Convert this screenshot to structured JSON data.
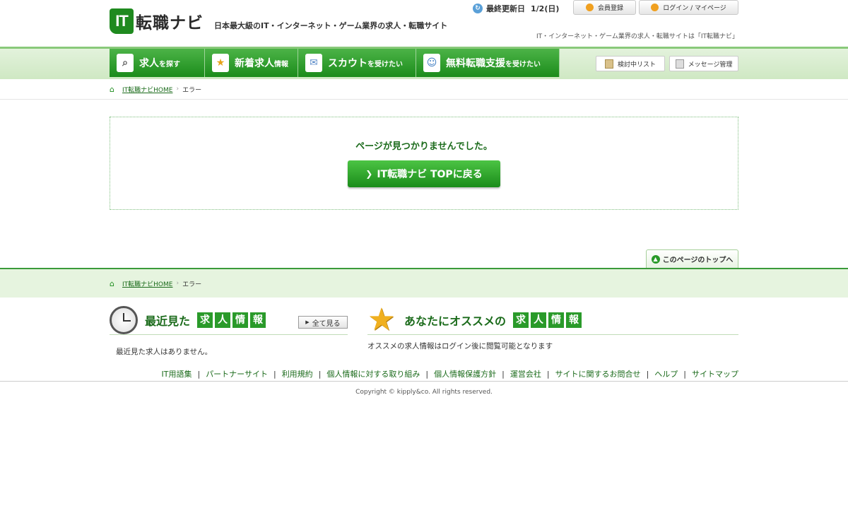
{
  "header": {
    "logo_it": "IT",
    "logo_text": "転職ナビ",
    "tagline": "日本最大級のIT・インターネット・ゲーム業界の求人・転職サイト",
    "update_label": "最終更新日",
    "update_date": "1/2(日)",
    "register_label": "会員登録",
    "login_label": "ログイン / マイページ",
    "note": "IT・インターネット・ゲーム業界の求人・転職サイトは「IT転職ナビ」"
  },
  "nav": {
    "items": [
      {
        "label": "求人",
        "small": "を探す",
        "icon": "search-icon"
      },
      {
        "label": "新着求人",
        "small": "情報",
        "icon": "star-icon"
      },
      {
        "label": "スカウト",
        "small": "を受けたい",
        "icon": "mail-icon"
      },
      {
        "label": "無料転職支援",
        "small": "を受けたい",
        "icon": "people-icon"
      }
    ],
    "list_label": "検討中リスト",
    "msg_label": "メッセージ管理"
  },
  "breadcrumb": {
    "home": "IT転職ナビHOME",
    "current": "エラー"
  },
  "error": {
    "message": "ページが見つかりませんでした。",
    "button": "IT転職ナビ TOPに戻る"
  },
  "pagetop": "このページのトップへ",
  "recent": {
    "title": "最近見た",
    "k1": "求",
    "k2": "人",
    "k3": "情",
    "k4": "報",
    "see_all": "全て見る",
    "body": "最近見た求人はありません。"
  },
  "recommend": {
    "title": "あなたにオススメの",
    "k1": "求",
    "k2": "人",
    "k3": "情",
    "k4": "報",
    "body": "オススメの求人情報はログイン後に閲覧可能となります"
  },
  "footer": {
    "links": [
      "IT用語集",
      "パートナーサイト",
      "利用規約",
      "個人情報に対する取り組み",
      "個人情報保護方針",
      "運営会社",
      "サイトに関するお問合せ",
      "ヘルプ",
      "サイトマップ"
    ],
    "copyright": "Copyright © kipply&co. All rights reserved."
  },
  "colors": {
    "brand_green": "#1b8c1b",
    "nav_light": "#cfe8c3"
  }
}
